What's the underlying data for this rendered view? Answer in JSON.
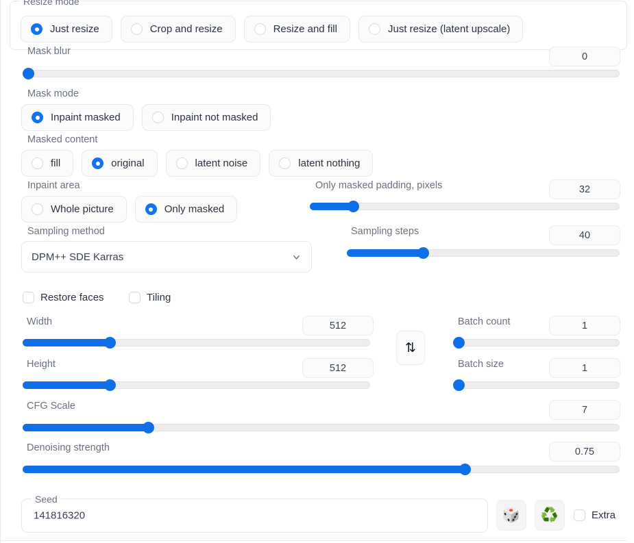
{
  "panel": {
    "resize_mode": {
      "legend": "Resize mode",
      "options": [
        {
          "label": "Just resize",
          "selected": true
        },
        {
          "label": "Crop and resize",
          "selected": false
        },
        {
          "label": "Resize and fill",
          "selected": false
        },
        {
          "label": "Just resize (latent upscale)",
          "selected": false
        }
      ]
    },
    "mask_blur": {
      "label": "Mask blur",
      "value": "0",
      "fill_percent": 0
    },
    "mask_mode": {
      "label": "Mask mode",
      "options": [
        {
          "label": "Inpaint masked",
          "selected": true
        },
        {
          "label": "Inpaint not masked",
          "selected": false
        }
      ]
    },
    "masked_content": {
      "label": "Masked content",
      "options": [
        {
          "label": "fill",
          "selected": false
        },
        {
          "label": "original",
          "selected": true
        },
        {
          "label": "latent noise",
          "selected": false
        },
        {
          "label": "latent nothing",
          "selected": false
        }
      ]
    },
    "inpaint_area": {
      "label": "Inpaint area",
      "options": [
        {
          "label": "Whole picture",
          "selected": false
        },
        {
          "label": "Only masked",
          "selected": true
        }
      ]
    },
    "only_masked_padding": {
      "label": "Only masked padding, pixels",
      "value": "32",
      "fill_percent": 14
    },
    "sampling_method": {
      "label": "Sampling method",
      "value": "DPM++ SDE Karras",
      "chevron_icon": "chevron-down-icon"
    },
    "sampling_steps": {
      "label": "Sampling steps",
      "value": "40",
      "fill_percent": 28
    },
    "restore_faces": {
      "label": "Restore faces",
      "checked": false
    },
    "tiling": {
      "label": "Tiling",
      "checked": false
    },
    "width": {
      "label": "Width",
      "value": "512",
      "fill_percent": 25
    },
    "height": {
      "label": "Height",
      "value": "512",
      "fill_percent": 25
    },
    "swap": {
      "icon": "swap-vertical-icon",
      "glyph": "⇅"
    },
    "batch_count": {
      "label": "Batch count",
      "value": "1",
      "fill_percent": 0
    },
    "batch_size": {
      "label": "Batch size",
      "value": "1",
      "fill_percent": 0
    },
    "cfg_scale": {
      "label": "CFG Scale",
      "value": "7",
      "fill_percent": 21
    },
    "denoising_strength": {
      "label": "Denoising strength",
      "value": "0.75",
      "fill_percent": 75
    },
    "seed": {
      "label": "Seed",
      "value": "141816320",
      "placeholder": "",
      "random_button": {
        "icon": "dice-icon",
        "glyph": "🎲"
      },
      "reuse_button": {
        "icon": "recycle-icon",
        "glyph": "♻️"
      },
      "extra": {
        "label": "Extra",
        "checked": false
      }
    }
  },
  "colors": {
    "accent": "#0f6fe8",
    "radio_selected": "#1472ec",
    "track": "#ededee",
    "border": "#e7e8ec",
    "label_text": "#6b7280",
    "value_text": "#374151"
  }
}
